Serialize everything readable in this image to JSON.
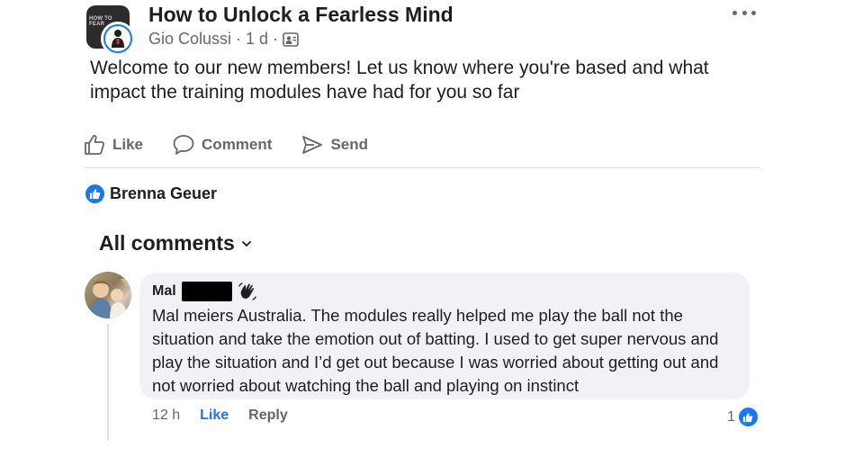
{
  "post": {
    "group_name": "How to Unlock a Fearless Mind",
    "group_cover_text": "HOW TO\nFEAR",
    "author": "Gio Colussi",
    "separator": "·",
    "time": "1 d",
    "audience_icon": "group-audience-icon",
    "body": "Welcome to our new members! Let us know where you're based and what impact the training modules have had for you so far",
    "more_icon": "more-horizontal-icon"
  },
  "actions": {
    "like_label": "Like",
    "comment_label": "Comment",
    "send_label": "Send"
  },
  "reactions": {
    "reactor_name": "Brenna Geuer",
    "icon": "like-thumb-icon"
  },
  "comments_header": {
    "label": "All comments",
    "icon": "chevron-down-icon"
  },
  "comment": {
    "author_first": "Mal",
    "badge_icon": "waving-hand-icon",
    "text": "Mal meiers Australia. The modules really helped me play the ball not the situation and take the emotion out of batting. I used to get super nervous and play the situation and I’d get out because I was worried about getting out and not worried about watching the ball and playing on instinct",
    "time": "12 h",
    "like_label": "Like",
    "reply_label": "Reply",
    "reaction_count": "1"
  },
  "colors": {
    "accent": "#1877f2",
    "secondary_text": "#65676b",
    "bubble": "#f0f2f5"
  }
}
